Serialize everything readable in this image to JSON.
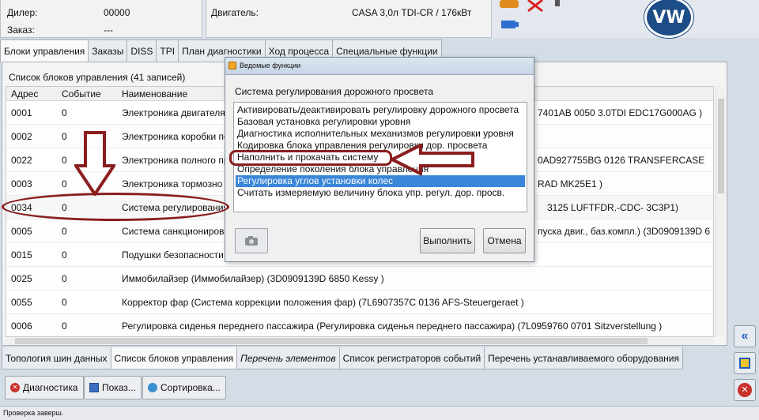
{
  "header": {
    "dealer_label": "Дилер:",
    "dealer_value": "00000",
    "order_label": "Заказ:",
    "order_value": "---",
    "engine_label": "Двигатель:",
    "engine_value": "CASA 3,0л TDI-CR / 176кВт",
    "logo_text": "VW"
  },
  "tabs": [
    {
      "label": "Блоки управления"
    },
    {
      "label": "Заказы"
    },
    {
      "label": "DISS"
    },
    {
      "label": "TPI"
    },
    {
      "label": "План диагностики"
    },
    {
      "label": "Ход процесса"
    },
    {
      "label": "Специальные функции"
    }
  ],
  "panel": {
    "title": "Список блоков управления (41 записей)",
    "columns": [
      "Адрес",
      "Событие",
      "Наименование"
    ]
  },
  "rows": [
    {
      "addr": "0001",
      "event": "0",
      "name": "Электроника двигателя",
      "tail": "7401AB    0050   3.0TDI EDC17G000AG )"
    },
    {
      "addr": "0002",
      "event": "0",
      "name": "Электроника коробки пе",
      "tail": ""
    },
    {
      "addr": "0022",
      "event": "0",
      "name": "Электроника полного пр",
      "tail": "0AD927755BG    0126   TRANSFERCASE"
    },
    {
      "addr": "0003",
      "event": "0",
      "name": "Электроника тормозно",
      "tail": "RAD MK25E1   )"
    },
    {
      "addr": "0034",
      "event": "0",
      "name": "Система регулирования",
      "tail": "3125    LUFTFDR.-CDC- 3C3P1)"
    },
    {
      "addr": "0005",
      "event": "0",
      "name": "Система санкционирова",
      "tail": "пуска двиг., баз.компл.) (3D0909139D     6"
    },
    {
      "addr": "0015",
      "event": "0",
      "name": "Подушки безопасности",
      "tail": ""
    },
    {
      "addr": "0025",
      "event": "0",
      "name": "Иммобилайзер (Иммобилайзер) (3D0909139D     6850     Kessy          )",
      "tail": ""
    },
    {
      "addr": "0055",
      "event": "0",
      "name": "Корректор фар (Система коррекции положения фар) (7L6907357C     0136    AFS-Steuergeraet   )",
      "tail": ""
    },
    {
      "addr": "0006",
      "event": "0",
      "name": "Регулировка сиденья переднего пассажира (Регулировка сиденья переднего пассажира) (7L0959760      0701   Sitzverstellung    )",
      "tail": ""
    }
  ],
  "bottom_tabs": [
    {
      "label": "Топология шин данных"
    },
    {
      "label": "Список блоков управления"
    },
    {
      "label": "Перечень элементов"
    },
    {
      "label": "Список регистраторов событий"
    },
    {
      "label": "Перечень устанавливаемого оборудования"
    }
  ],
  "buttons": {
    "diagnostics": "Диагностика",
    "show": "Показ...",
    "sort": "Сортировка..."
  },
  "status": "Проверка заверш.",
  "dialog": {
    "title": "Ведомые функции",
    "heading": "Система регулирования дорожного просвета",
    "items": [
      "Активировать/деактивировать регулировку дорожного просвета",
      "Базовая установка регулировки уровня",
      "Диагностика исполнительных механизмов регулировки уровня",
      "Кодировка блока управления регулировки дор. просвета",
      "Наполнить и прокачать систему",
      "Определение поколения блока управления",
      "Регулировка углов установки колес",
      "Считать измеряемую величину блока упр. регул. дор. просв."
    ],
    "selected_index": 6,
    "execute": "Выполнить",
    "cancel": "Отмена"
  },
  "colors": {
    "annotation": "#8a1e1e",
    "selection": "#3a86d9",
    "vw_blue": "#1d4d86"
  }
}
